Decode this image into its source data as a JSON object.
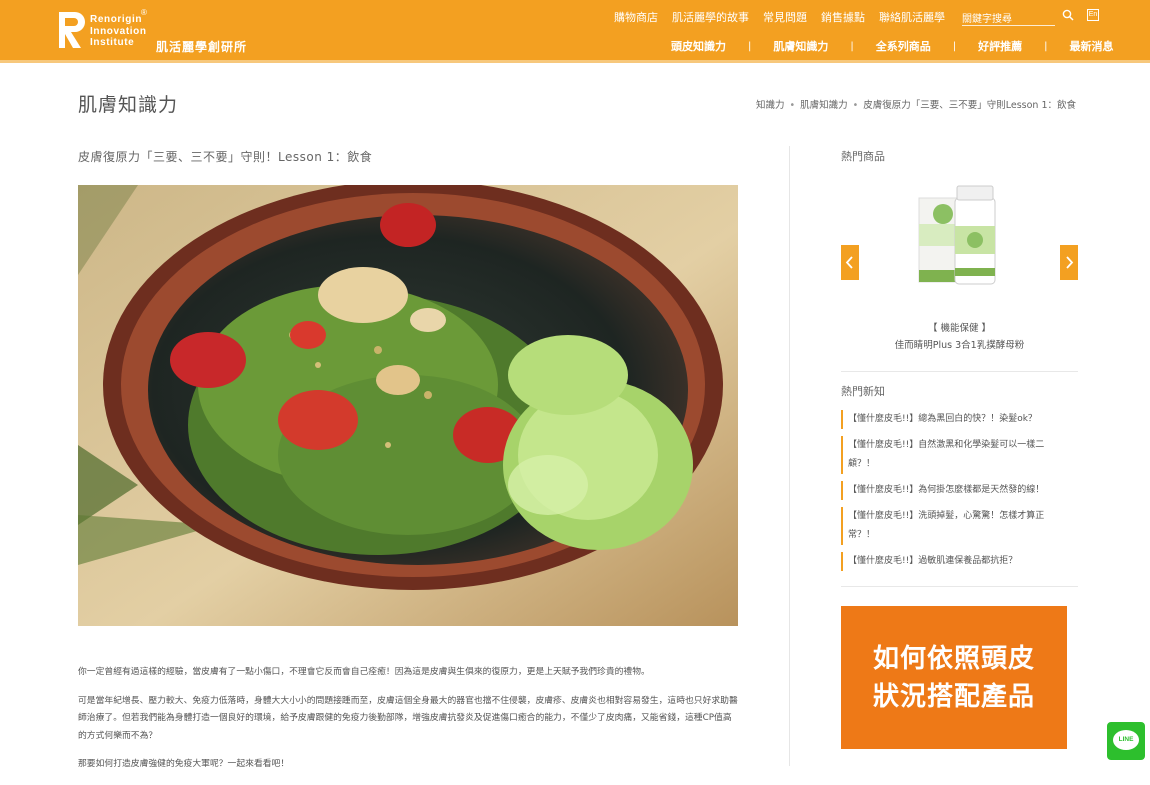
{
  "header": {
    "logo_en": [
      "Renorigin",
      "Innovation",
      "Institute"
    ],
    "logo_reg": "®",
    "logo_cn": "肌活麗學創研所",
    "top_nav": [
      "購物商店",
      "肌活麗學的故事",
      "常見問題",
      "銷售據點",
      "聯絡肌活麗學"
    ],
    "search_placeholder": "關鍵字搜尋",
    "lang_label": "En",
    "sub_nav": [
      "頭皮知識力",
      "肌膚知識力",
      "全系列商品",
      "好評推薦",
      "最新消息"
    ],
    "sub_nav_sep": "|"
  },
  "page": {
    "title": "肌膚知識力",
    "breadcrumb": [
      "知識力",
      "肌膚知識力",
      "皮膚復原力「三要、三不要」守則Lesson 1：飲食"
    ],
    "breadcrumb_sep": "•"
  },
  "article": {
    "title": "皮膚復原力「三要、三不要」守則！Lesson 1：飲食",
    "image_alt": "salad bowl",
    "paragraphs": [
      "你一定曾經有過這樣的經驗，當皮膚有了一點小傷口，不理會它反而會自己痊癒！因為這是皮膚與生俱來的復原力，更是上天賦予我們珍貴的禮物。",
      "可是當年紀增長、壓力較大、免疫力低落時，身體大大小小的問題接踵而至，皮膚這個全身最大的器官也擋不住侵襲，皮膚疹、皮膚炎也相對容易發生，這時也只好求助醫師治療了。但若我們能為身體打造一個良好的環境，給予皮膚跟健的免疫力後勤部隊，增強皮膚抗發炎及促進傷口癒合的能力，不僅少了皮肉痛，又能省錢，這種CP值高的方式何樂而不為？",
      "那要如何打造皮膚強健的免疫大軍呢？一起來看看吧！"
    ]
  },
  "sidebar": {
    "hot_products_title": "熱門商品",
    "product_category": "【 機能保健 】",
    "product_name": "佳而睛明Plus 3合1乳撲酵母粉",
    "hot_news_title": "熱門新知",
    "news": [
      "【懂什麼皮毛!!】總為黑回白的快？！染髮ok？",
      "【懂什麼皮毛!!】自然激黑和化學染髮可以一樣二顧？！",
      "【懂什麼皮毛!!】為何掛怎麼樣都是天然發的線！",
      "【懂什麼皮毛!!】洗頭掉髮，心驚驚！怎樣才算正常？！",
      "【懂什麼皮毛!!】過敏肌連保養品都抗拒？"
    ],
    "banner_lines": [
      "如何依照頭皮",
      "狀況搭配產品"
    ]
  },
  "line_button": {
    "label": "LINE"
  },
  "colors": {
    "brand_orange": "#f3a021",
    "banner_orange": "#ee7917",
    "line_green": "#2dbf2d"
  }
}
